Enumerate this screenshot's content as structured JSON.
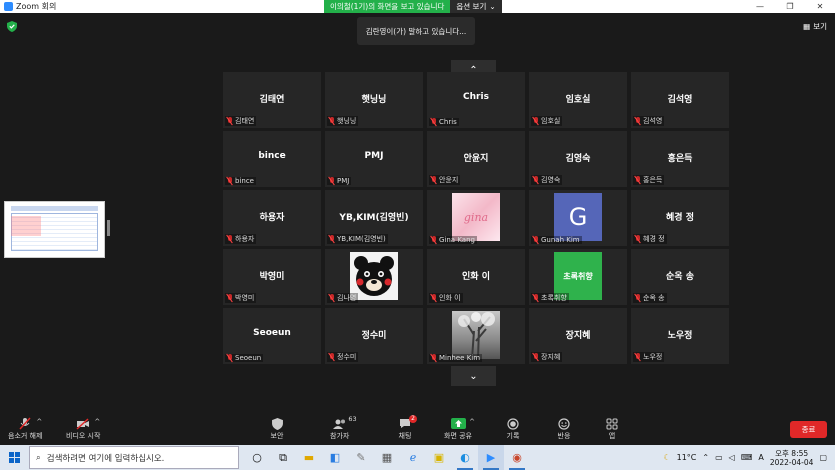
{
  "window": {
    "title": "Zoom 회의",
    "controls": [
      "—",
      "❐",
      "✕"
    ]
  },
  "share_banner": {
    "message": "이의철(1기)의 화면을 보고 있습니다",
    "options_label": "옵션 보기",
    "options_caret": "⌄"
  },
  "top": {
    "view_label": "보기",
    "view_icon": "grid-icon",
    "speaking_toast": "김란영이(가) 말하고 있습니다..."
  },
  "pager": {
    "up": "⌃",
    "down": "⌄"
  },
  "tiles": [
    {
      "big": "김태연",
      "label": "김태연"
    },
    {
      "big": "햇닝닝",
      "label": "햇닝닝"
    },
    {
      "big": "Chris",
      "label": "Chris"
    },
    {
      "big": "임호실",
      "label": "임호실"
    },
    {
      "big": "김석영",
      "label": "김석영"
    },
    {
      "big": "bince",
      "label": "bince"
    },
    {
      "big": "PMJ",
      "label": "PMJ"
    },
    {
      "big": "안윤지",
      "label": "안윤지"
    },
    {
      "big": "김영숙",
      "label": "김영숙"
    },
    {
      "big": "홍은득",
      "label": "홍은득"
    },
    {
      "big": "하용자",
      "label": "하용자"
    },
    {
      "big": "YB,KIM(김영빈)",
      "label": "YB,KIM(김영빈)"
    },
    {
      "big": "",
      "label": "Gina Kang",
      "avatar": "gina"
    },
    {
      "big": "",
      "label": "Gunah Kim",
      "avatar": "G"
    },
    {
      "big": "혜경 정",
      "label": "혜경 정"
    },
    {
      "big": "박영미",
      "label": "박영미"
    },
    {
      "big": "",
      "label": "김나영",
      "avatar": "bear"
    },
    {
      "big": "인화 이",
      "label": "인화 이"
    },
    {
      "big": "",
      "label": "초록취향",
      "avatar": "green"
    },
    {
      "big": "순옥 송",
      "label": "순옥 송"
    },
    {
      "big": "Seoeun",
      "label": "Seoeun"
    },
    {
      "big": "정수미",
      "label": "정수미"
    },
    {
      "big": "",
      "label": "Minhee Kim",
      "avatar": "tree"
    },
    {
      "big": "장지혜",
      "label": "장지혜"
    },
    {
      "big": "노우정",
      "label": "노우정"
    }
  ],
  "avatar_text": {
    "gina": "gina",
    "G": "G",
    "green": "초록취향"
  },
  "controls": {
    "unmute": "음소거 해제",
    "video": "비디오 시작",
    "security": "보안",
    "participants": "참가자",
    "participants_count": "63",
    "chat": "채팅",
    "chat_badge": "2",
    "share": "화면 공유",
    "record": "기록",
    "reactions": "반응",
    "apps": "앱",
    "end": "종료"
  },
  "taskbar": {
    "search_placeholder": "검색하려면 여기에 입력하십시오.",
    "weather": "11°C",
    "ime": "A",
    "time": "오후 8:55",
    "date": "2022-04-04"
  },
  "colors": {
    "accent_green": "#23b04a",
    "end_red": "#e02828",
    "tile_bg": "#262626",
    "gunah_avatar": "#5566b8",
    "green_avatar": "#2fb24c"
  }
}
